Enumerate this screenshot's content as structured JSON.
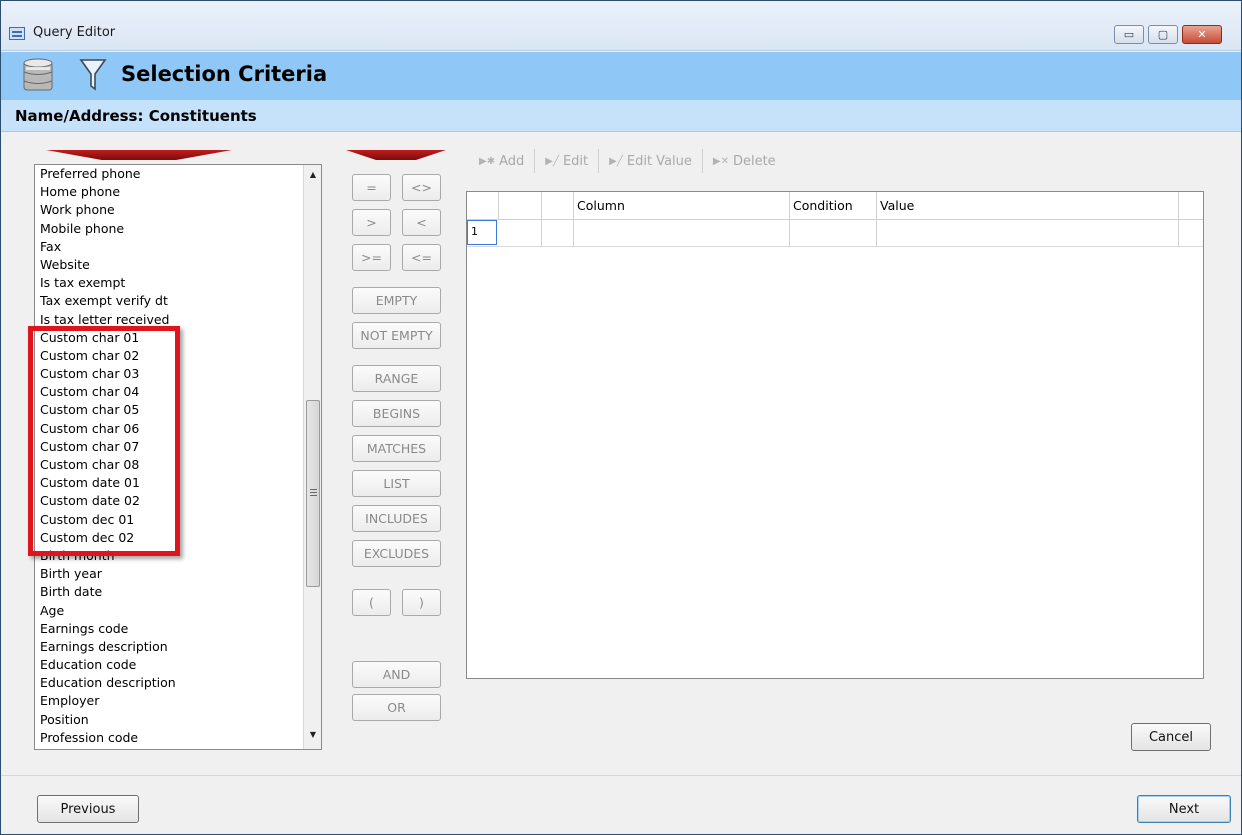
{
  "window": {
    "title": "Query Editor",
    "controls": {
      "minimize": "▭",
      "maximize": "▢",
      "close": "✕"
    }
  },
  "header": {
    "title": "Selection Criteria",
    "icons": [
      "database-icon",
      "filter-funnel-icon"
    ]
  },
  "subheader": {
    "title": "Name/Address: Constituents"
  },
  "field_list": {
    "items": [
      "Preferred phone",
      "Home phone",
      "Work phone",
      "Mobile phone",
      "Fax",
      "Website",
      "Is tax exempt",
      "Tax exempt verify dt",
      "Is tax letter received",
      "Custom char 01",
      "Custom char 02",
      "Custom char 03",
      "Custom char 04",
      "Custom char 05",
      "Custom char 06",
      "Custom char 07",
      "Custom char 08",
      "Custom date 01",
      "Custom date 02",
      "Custom dec 01",
      "Custom dec 02",
      "Birth month",
      "Birth year",
      "Birth date",
      "Age",
      "Earnings code",
      "Earnings description",
      "Education code",
      "Education description",
      "Employer",
      "Position",
      "Profession code"
    ]
  },
  "operators": {
    "eq": "=",
    "ne": "<>",
    "gt": ">",
    "lt": "<",
    "ge": ">=",
    "le": "<=",
    "empty": "EMPTY",
    "not_empty": "NOT EMPTY",
    "range": "RANGE",
    "begins": "BEGINS",
    "matches": "MATCHES",
    "list": "LIST",
    "includes": "INCLUDES",
    "excludes": "EXCLUDES",
    "open_paren": "(",
    "close_paren": ")",
    "and": "AND",
    "or": "OR"
  },
  "toolbar": {
    "add": "Add",
    "edit": "Edit",
    "edit_value": "Edit Value",
    "delete": "Delete"
  },
  "grid": {
    "columns": [
      "",
      "",
      "Column",
      "Condition",
      "Value"
    ],
    "rows": [
      {
        "num": "1",
        "column": "",
        "condition": "",
        "value": ""
      }
    ]
  },
  "buttons": {
    "cancel": "Cancel",
    "previous": "Previous",
    "next": "Next"
  },
  "colors": {
    "header_band": "#8fc7f7",
    "sub_band": "#c6e1fa",
    "highlight": "#e0141b",
    "arrow": "#b01818"
  }
}
